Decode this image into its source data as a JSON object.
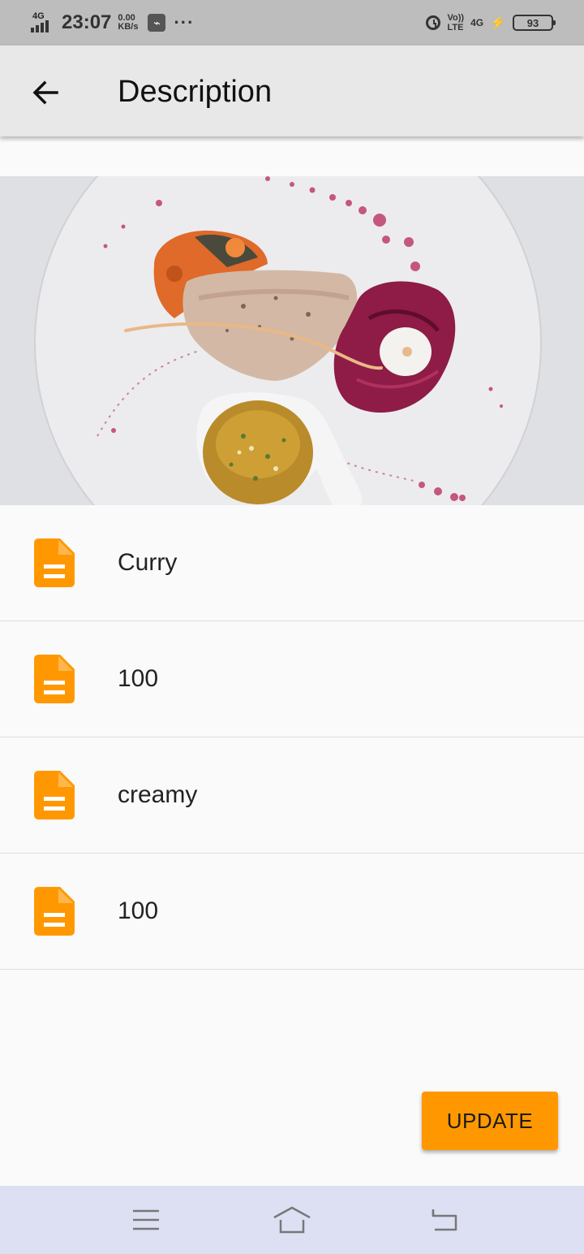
{
  "status_bar": {
    "network_type": "4G",
    "time": "23:07",
    "speed_value": "0.00",
    "speed_unit": "KB/s",
    "more": "···",
    "volte_top": "Vo))",
    "volte_bottom": "LTE",
    "network_right": "4G",
    "battery": "93"
  },
  "app_bar": {
    "title": "Description"
  },
  "items": [
    {
      "text": "Curry"
    },
    {
      "text": "100"
    },
    {
      "text": "creamy"
    },
    {
      "text": "100"
    }
  ],
  "actions": {
    "update_label": "UPDATE"
  },
  "colors": {
    "accent": "#ff9800",
    "app_bar": "#e8e8e8",
    "nav_bar": "#dde0f3"
  }
}
